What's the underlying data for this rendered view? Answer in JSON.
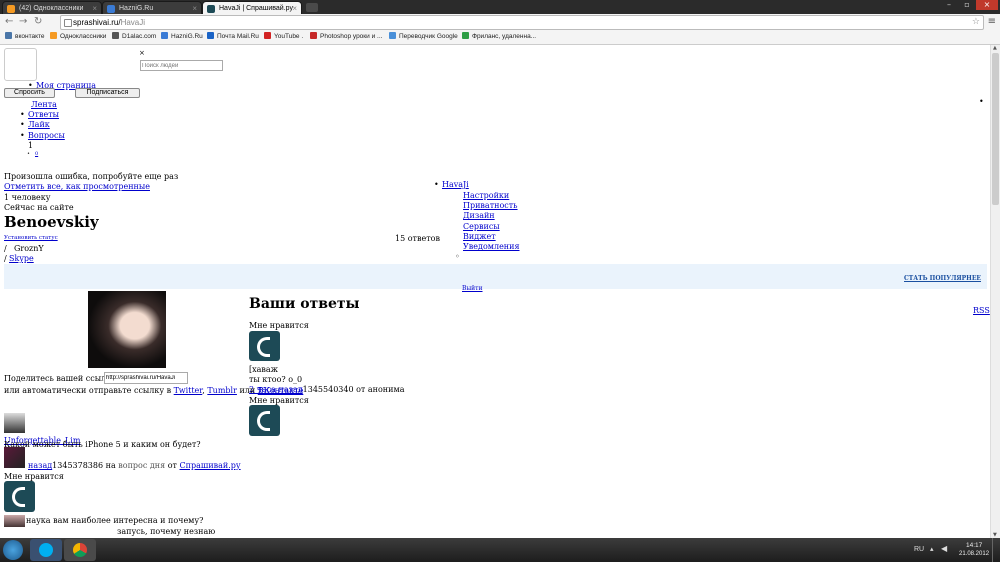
{
  "browser": {
    "tabs": [
      {
        "title": "(42) Одноклассники",
        "active": false,
        "color": "#f59a23"
      },
      {
        "title": "HazniG.Ru",
        "active": false,
        "color": "#3a7bd5"
      },
      {
        "title": "HavaJi | Спрашивай.ру",
        "active": true,
        "color": "#1d4a56"
      }
    ],
    "url_host": "sprashivai.ru/",
    "url_path": "HavaJi",
    "bookmarks": [
      {
        "label": "вконтакте",
        "color": "#4a76a8"
      },
      {
        "label": "Одноклассники",
        "color": "#f59a23"
      },
      {
        "label": "D1alac.com",
        "color": "#555555"
      },
      {
        "label": "HazniG.Ru",
        "color": "#3a7bd5"
      },
      {
        "label": "Почта Mail.Ru",
        "color": "#1a63c6"
      },
      {
        "label": "YouTube .",
        "color": "#d22222"
      },
      {
        "label": "Photoshop уроки и ...",
        "color": "#c62828"
      },
      {
        "label": "Переводчик Google",
        "color": "#4a90d9"
      },
      {
        "label": "Фриланс, удаленна...",
        "color": "#2e9e45"
      }
    ]
  },
  "page": {
    "close_mark": "×",
    "search_placeholder": "Поиск людей",
    "my_page": "Моя страница",
    "ask_button": "Спросить",
    "subscribe_button": "Подписаться",
    "nav": [
      "Лента",
      "Ответы",
      "Лайк",
      "Вопросы"
    ],
    "nav_count": "1",
    "nav_small_link": "0",
    "error_message": "Произошла ошибка, попробуйте еще раз",
    "mark_all_read": "Отметить все, как просмотренные",
    "online_count": "1 человеку",
    "online_now": "Сейчас на сайте",
    "user_menu_name": "HavaJi",
    "user_menu_items": [
      "Настройки",
      "Приватность",
      "Дизайн",
      "Сервисы",
      "Виджет",
      "Уведомления"
    ],
    "user_menu_exit": "Выйти",
    "profile_name": "Benoevskiy",
    "set_status": "Установить статус",
    "answers_count": "15 ответов",
    "city_sep": "/",
    "city": "GroznY",
    "skype_sep": "/",
    "skype": "Skype",
    "become_popular": "СТАТЬ ПОПУЛЯРНЕЕ",
    "answers_heading": "Ваши ответы",
    "rss": "RSS",
    "share_label": "Поделитесь вашей ссылкой:",
    "share_url": "http://sprashivai.ru/HavaJi",
    "share_auto": "или автоматически отправьте ссылку в",
    "share_twitter": "Twitter",
    "share_tumblr": "Tumblr",
    "share_or": "или",
    "share_vk": "ВКонтакте",
    "like1": "Мне нравится",
    "answer_text_1": "[хавaж",
    "answer_text_2": "ты ктоо? о_0",
    "time_ago": "2 часа назад",
    "answer_meta": "1345540340 от анонима",
    "like2": "Мне нравится",
    "feed_user": "Unforgettable_Lim",
    "feed_question": "Какой может быть iPhone 5 и каким он будет?",
    "feed_time_link": "назад",
    "feed_meta_prefix": "1345378386 на",
    "feed_meta_qday": "вопрос дня",
    "feed_meta_from": "от",
    "feed_meta_site": "Спрашивай.ру",
    "feed_like": "Мне нравится",
    "feed_question_2": "наука вам наиболее интересна и почему?",
    "feed_answer_2": "запусь, почему незнаю"
  },
  "taskbar": {
    "lang": "RU",
    "time": "14:17",
    "date": "21.08.2012"
  },
  "colors": {
    "accent_bubble": "#1d4a56",
    "banner_bg": "#eaf3fc",
    "link": "#0000cc"
  }
}
